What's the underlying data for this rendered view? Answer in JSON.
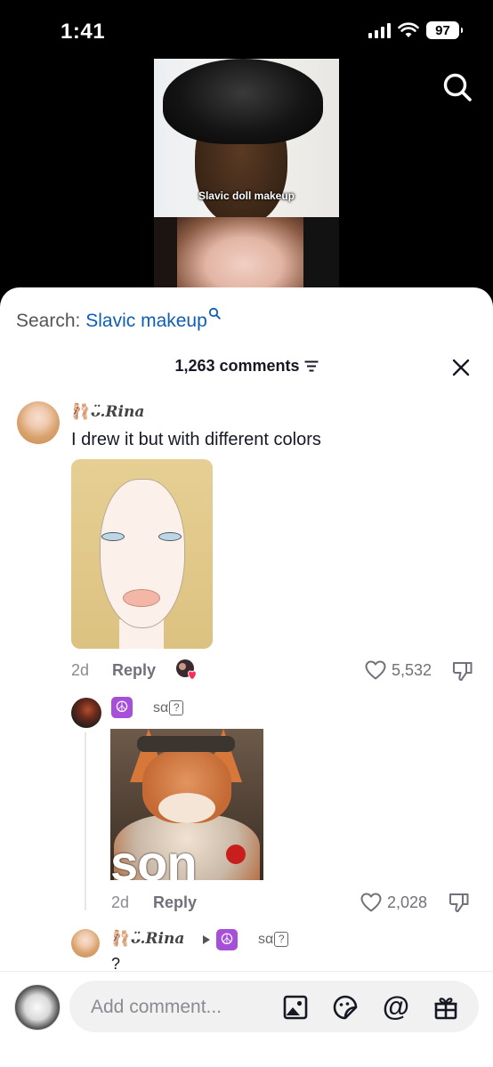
{
  "status_bar": {
    "time": "1:41",
    "battery": "97"
  },
  "video": {
    "caption": "Slavic doll makeup"
  },
  "sheet": {
    "search_label": "Search:",
    "search_query": "Slavic makeup",
    "comment_count": "1,263 comments"
  },
  "comments": [
    {
      "username": "ᴗ̈.Rina",
      "user_emoji": "🩰",
      "text": "I drew it but with different colors",
      "age": "2d",
      "reply_label": "Reply",
      "likes": "5,532"
    }
  ],
  "replies": [
    {
      "badge": "☮",
      "username": "sα",
      "age": "2d",
      "reply_label": "Reply",
      "likes": "2,028",
      "image_caption": "son"
    },
    {
      "username": "ᴗ̈.Rina",
      "user_emoji": "🩰",
      "reply_to_badge": "☮",
      "reply_to": "sα",
      "text": "?"
    }
  ],
  "composer": {
    "placeholder": "Add comment..."
  },
  "colors": {
    "search_link": "#0f5eb5",
    "peace_badge": "#a64fd8",
    "like_heart": "#fe2c55"
  }
}
